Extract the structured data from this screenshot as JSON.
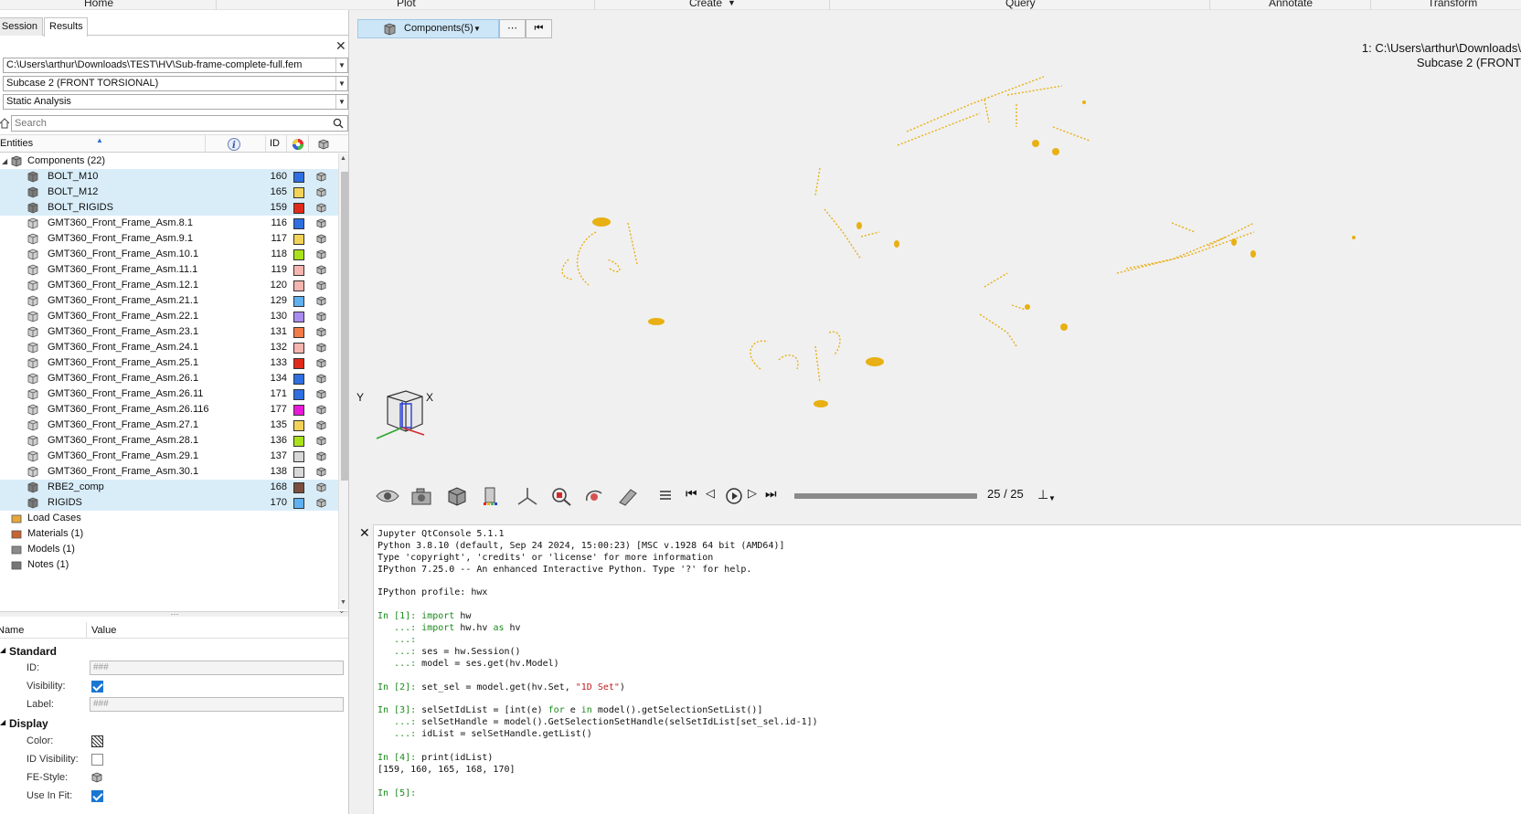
{
  "ribbon": {
    "tabs": [
      "Home",
      "Plot",
      "Create",
      "Query",
      "Annotate",
      "Transform"
    ]
  },
  "panel": {
    "tabs": [
      "Session",
      "Results"
    ],
    "file": "C:\\Users\\arthur\\Downloads\\TEST\\HV\\Sub-frame-complete-full.fem",
    "subcase": "Subcase 2 (FRONT TORSIONAL)",
    "analysis": "Static Analysis",
    "search_placeholder": "Search",
    "columns": {
      "entities": "Entities",
      "id": "ID"
    }
  },
  "tree": {
    "components_label": "Components (22)",
    "items": [
      {
        "name": "BOLT_M10",
        "id": "160",
        "color": "#2f6fe0",
        "sel": true
      },
      {
        "name": "BOLT_M12",
        "id": "165",
        "color": "#f3d25a",
        "sel": true
      },
      {
        "name": "BOLT_RIGIDS",
        "id": "159",
        "color": "#e02a1a",
        "sel": true
      },
      {
        "name": "GMT360_Front_Frame_Asm.8.1",
        "id": "116",
        "color": "#2f6fe0",
        "sel": false
      },
      {
        "name": "GMT360_Front_Frame_Asm.9.1",
        "id": "117",
        "color": "#f3d25a",
        "sel": false
      },
      {
        "name": "GMT360_Front_Frame_Asm.10.1",
        "id": "118",
        "color": "#a9e21a",
        "sel": false
      },
      {
        "name": "GMT360_Front_Frame_Asm.11.1",
        "id": "119",
        "color": "#f7b5b0",
        "sel": false
      },
      {
        "name": "GMT360_Front_Frame_Asm.12.1",
        "id": "120",
        "color": "#f7b5b0",
        "sel": false
      },
      {
        "name": "GMT360_Front_Frame_Asm.21.1",
        "id": "129",
        "color": "#5fb0ef",
        "sel": false
      },
      {
        "name": "GMT360_Front_Frame_Asm.22.1",
        "id": "130",
        "color": "#a98cf0",
        "sel": false
      },
      {
        "name": "GMT360_Front_Frame_Asm.23.1",
        "id": "131",
        "color": "#f47a4a",
        "sel": false
      },
      {
        "name": "GMT360_Front_Frame_Asm.24.1",
        "id": "132",
        "color": "#f7b5b0",
        "sel": false
      },
      {
        "name": "GMT360_Front_Frame_Asm.25.1",
        "id": "133",
        "color": "#e02a1a",
        "sel": false
      },
      {
        "name": "GMT360_Front_Frame_Asm.26.1",
        "id": "134",
        "color": "#2f6fe0",
        "sel": false
      },
      {
        "name": "GMT360_Front_Frame_Asm.26.11",
        "id": "171",
        "color": "#2f6fe0",
        "sel": false
      },
      {
        "name": "GMT360_Front_Frame_Asm.26.116",
        "id": "177",
        "color": "#e81ad8",
        "sel": false
      },
      {
        "name": "GMT360_Front_Frame_Asm.27.1",
        "id": "135",
        "color": "#f3d25a",
        "sel": false
      },
      {
        "name": "GMT360_Front_Frame_Asm.28.1",
        "id": "136",
        "color": "#a9e21a",
        "sel": false
      },
      {
        "name": "GMT360_Front_Frame_Asm.29.1",
        "id": "137",
        "color": "#d8d8d8",
        "sel": false
      },
      {
        "name": "GMT360_Front_Frame_Asm.30.1",
        "id": "138",
        "color": "#d8d8d8",
        "sel": false
      },
      {
        "name": "RBE2_comp",
        "id": "168",
        "color": "#7a4f3f",
        "sel": true
      },
      {
        "name": "RIGIDS",
        "id": "170",
        "color": "#5fb0ef",
        "sel": true
      }
    ],
    "others": [
      "Load Cases",
      "Materials (1)",
      "Models (1)",
      "Notes (1)"
    ]
  },
  "props": {
    "col_name": "Name",
    "col_value": "Value",
    "standard": "Standard",
    "display": "Display",
    "id_label": "ID:",
    "id_value": "###",
    "visibility_label": "Visibility:",
    "label_label": "Label:",
    "label_value": "###",
    "color_label": "Color:",
    "id_visibility_label": "ID Visibility:",
    "fe_style_label": "FE-Style:",
    "use_in_fit_label": "Use In Fit:"
  },
  "viewport": {
    "components_button": "Components(5)",
    "more_button": "⋯",
    "title_line1": "1: C:\\Users\\arthur\\Downloads\\",
    "title_line2": "Subcase 2 (FRONT",
    "axis_x": "X",
    "axis_y": "Y",
    "frame": "25 / 25",
    "accent_color": "#e8b012"
  },
  "console": {
    "lines": [
      {
        "t": "plain",
        "text": "Jupyter QtConsole 5.1.1"
      },
      {
        "t": "plain",
        "text": "Python 3.8.10 (default, Sep 24 2024, 15:00:23) [MSC v.1928 64 bit (AMD64)]"
      },
      {
        "t": "plain",
        "text": "Type 'copyright', 'credits' or 'license' for more information"
      },
      {
        "t": "plain",
        "text": "IPython 7.25.0 -- An enhanced Interactive Python. Type '?' for help."
      },
      {
        "t": "plain",
        "text": ""
      },
      {
        "t": "plain",
        "text": "IPython profile: hwx"
      },
      {
        "t": "plain",
        "text": ""
      },
      {
        "t": "in",
        "prompt": "In [1]: ",
        "code": "import hw"
      },
      {
        "t": "cont",
        "prompt": "   ...: ",
        "code": "import hw.hv as hv"
      },
      {
        "t": "cont",
        "prompt": "   ...: ",
        "code": ""
      },
      {
        "t": "cont",
        "prompt": "   ...: ",
        "code": "ses = hw.Session()"
      },
      {
        "t": "cont",
        "prompt": "   ...: ",
        "code": "model = ses.get(hv.Model)"
      },
      {
        "t": "plain",
        "text": ""
      },
      {
        "t": "in",
        "prompt": "In [2]: ",
        "code": "set_sel = model.get(hv.Set, \"1D Set\")"
      },
      {
        "t": "plain",
        "text": ""
      },
      {
        "t": "in",
        "prompt": "In [3]: ",
        "code": "selSetIdList = [int(e) for e in model().getSelectionSetList()]"
      },
      {
        "t": "cont",
        "prompt": "   ...: ",
        "code": "selSetHandle = model().GetSelectionSetHandle(selSetIdList[set_sel.id-1])"
      },
      {
        "t": "cont",
        "prompt": "   ...: ",
        "code": "idList = selSetHandle.getList()"
      },
      {
        "t": "plain",
        "text": ""
      },
      {
        "t": "in",
        "prompt": "In [4]: ",
        "code": "print(idList)"
      },
      {
        "t": "plain",
        "text": "[159, 160, 165, 168, 170]"
      },
      {
        "t": "plain",
        "text": ""
      },
      {
        "t": "in",
        "prompt": "In [5]: ",
        "code": ""
      }
    ]
  }
}
